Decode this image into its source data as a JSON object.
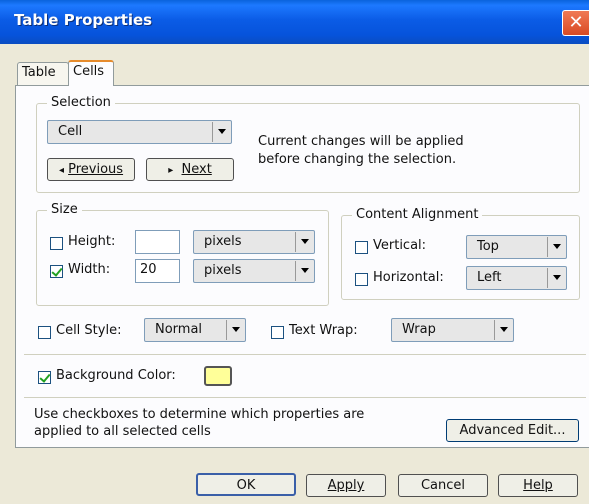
{
  "window": {
    "title": "Table Properties",
    "close_glyph": "✕"
  },
  "tabs": [
    {
      "label": "Table"
    },
    {
      "label": "Cells"
    }
  ],
  "selection": {
    "group_label": "Selection",
    "dropdown_value": "Cell",
    "previous_label": "Previous",
    "next_label": "Next",
    "info_line1": "Current changes will be applied",
    "info_line2": "before changing the selection."
  },
  "size": {
    "group_label": "Size",
    "height_label": "Height:",
    "height_value": "",
    "height_unit": "pixels",
    "height_checked": false,
    "width_label": "Width:",
    "width_value": "20",
    "width_unit": "pixels",
    "width_checked": true
  },
  "alignment": {
    "group_label": "Content Alignment",
    "vertical_label": "Vertical:",
    "vertical_value": "Top",
    "horizontal_label": "Horizontal:",
    "horizontal_value": "Left"
  },
  "cell_style": {
    "label": "Cell Style:",
    "value": "Normal"
  },
  "text_wrap": {
    "label": "Text Wrap:",
    "value": "Wrap"
  },
  "background": {
    "label": "Background Color:",
    "color": "#ffff99",
    "checked": true
  },
  "hint": {
    "line1": "Use checkboxes to determine which properties are",
    "line2": "applied to all selected cells"
  },
  "advanced_label": "Advanced Edit...",
  "buttons": {
    "ok": "OK",
    "apply": "Apply",
    "cancel": "Cancel",
    "help": "Help"
  },
  "colors": {
    "titlebar": "#0653db",
    "dialog_bg": "#ece9d8",
    "panel_bg": "#fcfcfe",
    "tab_accent": "#e68b2c"
  }
}
